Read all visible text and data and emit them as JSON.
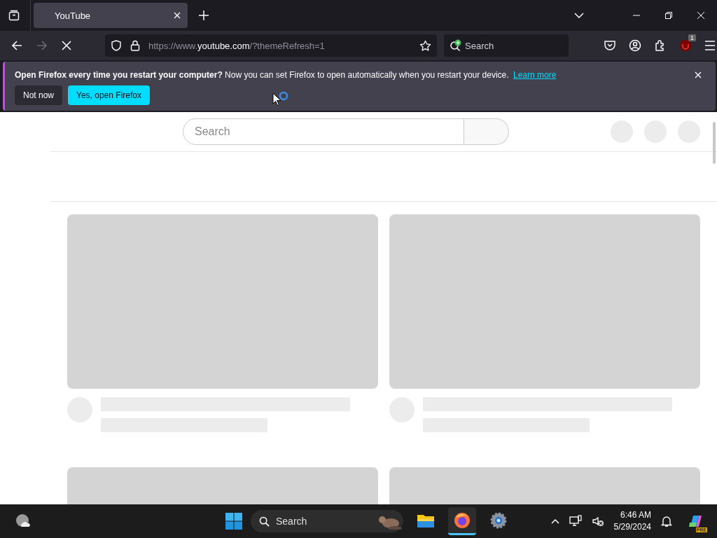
{
  "tabs": [
    {
      "title": "YouTube",
      "selected": true
    }
  ],
  "toolbar": {
    "url_prefix": "https://www.",
    "url_domain": "youtube.com",
    "url_suffix": "/?themeRefresh=1",
    "search_placeholder": "Search",
    "extension_badge": "1",
    "loading": true
  },
  "notification": {
    "title": "Open Firefox every time you restart your computer?",
    "message": "Now you can set Firefox to open automatically when you restart your device.",
    "link": "Learn more",
    "buttons": [
      {
        "label": "Not now",
        "kind": "secondary"
      },
      {
        "label": "Yes, open Firefox",
        "kind": "primary"
      }
    ]
  },
  "page": {
    "search_placeholder": "Search",
    "cards": [
      {
        "kind": "skeleton"
      },
      {
        "kind": "skeleton"
      },
      {
        "kind": "partial"
      },
      {
        "kind": "partial"
      }
    ]
  },
  "taskbar": {
    "search_placeholder": "Search",
    "apps": [
      {
        "kind": "files",
        "selected": false
      },
      {
        "kind": "firefox",
        "selected": true
      },
      {
        "kind": "settings",
        "selected": false
      }
    ],
    "time": "6:46 AM",
    "date": "5/29/2024",
    "copilot_badge": "PRE"
  }
}
